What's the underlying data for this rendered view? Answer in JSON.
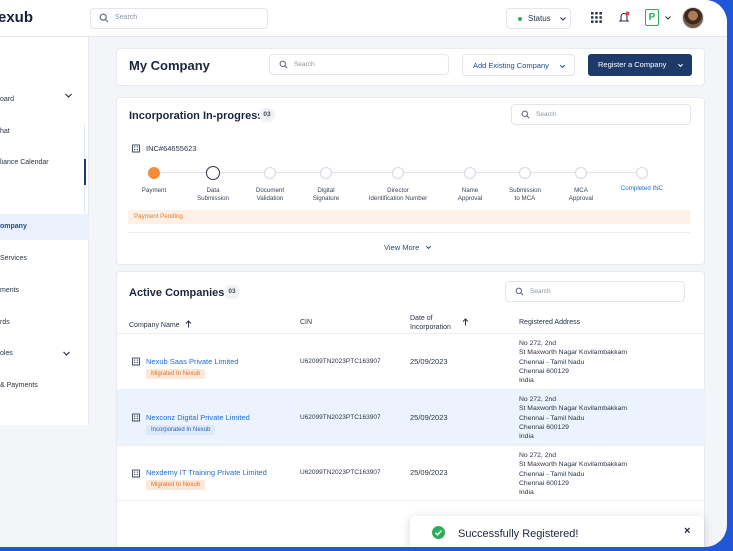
{
  "app": {
    "logo": "exub"
  },
  "topbar": {
    "search_placeholder": "Search",
    "status_label": "Status",
    "profile_letter": "P"
  },
  "sidebar": {
    "items": [
      {
        "label": "oard"
      },
      {
        "label": "hat"
      },
      {
        "label": "liance Calendar"
      },
      {
        "label": "ompany",
        "active": true
      },
      {
        "label": "Services"
      },
      {
        "label": "ments"
      },
      {
        "label": "rds"
      },
      {
        "label": "oles"
      },
      {
        "label": "& Payments"
      }
    ]
  },
  "header": {
    "title": "My Company",
    "search_placeholder": "Search",
    "add_existing_label": "Add Existing Company",
    "register_label": "Register a Company"
  },
  "incorporation": {
    "title": "Incorporation In-progress",
    "count": "03",
    "search_placeholder": "Search",
    "inc_id": "INC#64655623",
    "steps": [
      {
        "l1": "Payment",
        "l2": "",
        "state": "done"
      },
      {
        "l1": "Data",
        "l2": "Submission",
        "state": "current"
      },
      {
        "l1": "Document",
        "l2": "Validation",
        "state": "pending"
      },
      {
        "l1": "Digital",
        "l2": "Signature",
        "state": "pending"
      },
      {
        "l1": "Director",
        "l2": "Identification Number",
        "state": "pending"
      },
      {
        "l1": "Name",
        "l2": "Approval",
        "state": "pending"
      },
      {
        "l1": "Submission",
        "l2": "to MCA",
        "state": "pending"
      },
      {
        "l1": "MCA",
        "l2": "Approval",
        "state": "pending"
      },
      {
        "l1": "Completed INC",
        "l2": "",
        "state": "final"
      }
    ],
    "pending_note": "Payment Pending",
    "view_more": "View More"
  },
  "active": {
    "title": "Active Companies",
    "count": "03",
    "search_placeholder": "Search",
    "columns": {
      "name": "Company Name",
      "cin": "CIN",
      "date_l1": "Date of",
      "date_l2": "Incorporation",
      "address": "Registered Address"
    },
    "rows": [
      {
        "name": "Nexub Saas Private Limited",
        "badge": "Migrated to Nexub",
        "badge_color": "orange",
        "cin": "U62099TN2023PTC163907",
        "date": "25/09/2023",
        "addr": [
          "No 272, 2nd",
          "St Maxworth Nagar Kovilambakkam",
          "Chennai - Tamil Nadu",
          "Chennai 600129",
          "India"
        ]
      },
      {
        "name": "Nexconz Digital Private Limited",
        "badge": "Incorporated In Nexub",
        "badge_color": "blue",
        "cin": "U62099TN2023PTC163907",
        "date": "25/09/2023",
        "addr": [
          "No 272, 2nd",
          "St Maxworth Nagar Kovilambakkam",
          "Chennai - Tamil Nadu",
          "Chennai 600129",
          "India"
        ]
      },
      {
        "name": "Nexdemy IT Training Private Limited",
        "badge": "Migrated to Nexub",
        "badge_color": "orange",
        "cin": "U62099TN2023PTC163907",
        "date": "25/09/2023",
        "addr": [
          "No 272, 2nd",
          "St Maxworth Nagar Kovilambakkam",
          "Chennai - Tamil Nadu",
          "Chennai 600129",
          "India"
        ]
      }
    ]
  },
  "toast": {
    "message": "Successfully Registered!"
  },
  "colors": {
    "brand_navy": "#1d3a6b",
    "link_blue": "#1f6bd6",
    "accent_orange": "#f38b3c",
    "success_green": "#2eaa5a"
  }
}
